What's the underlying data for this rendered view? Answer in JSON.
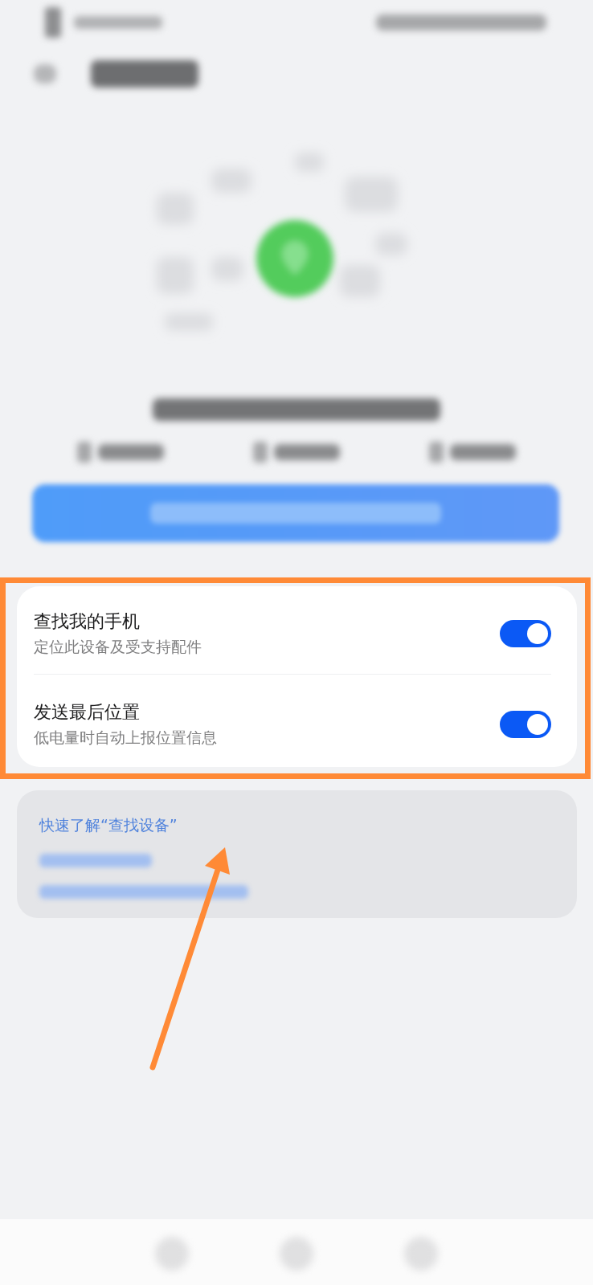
{
  "settings_card": {
    "items": [
      {
        "title": "查找我的手机",
        "subtitle": "定位此设备及受支持配件",
        "on": true
      },
      {
        "title": "发送最后位置",
        "subtitle": "低电量时自动上报位置信息",
        "on": true
      }
    ]
  },
  "help_card": {
    "links": [
      {
        "text": "快速了解“查找设备”"
      }
    ]
  }
}
